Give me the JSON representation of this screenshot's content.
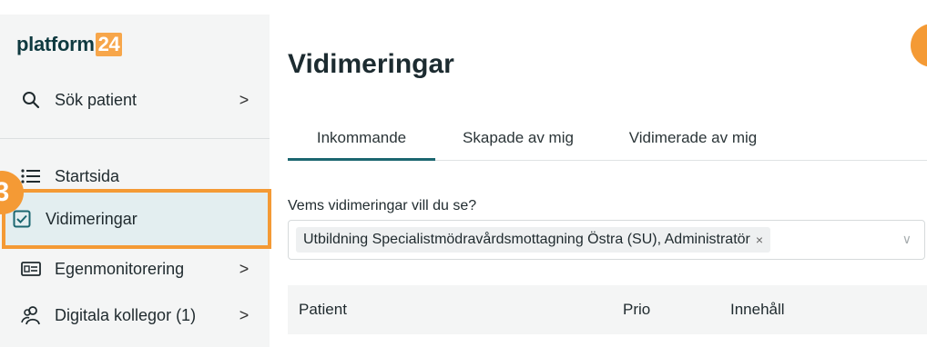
{
  "logo": {
    "text": "platform",
    "badge": "24"
  },
  "sidebar": {
    "items": [
      {
        "label": "Sök patient",
        "icon": "search-icon",
        "chevron": ">"
      },
      {
        "label": "Startsida",
        "icon": "list-icon"
      },
      {
        "label": "Vidimeringar",
        "icon": "checkbox-icon"
      },
      {
        "label": "Egenmonitorering",
        "icon": "id-card-icon",
        "chevron": ">"
      },
      {
        "label": "Digitala kollegor (1)",
        "icon": "people-icon",
        "chevron": ">"
      }
    ],
    "step_number": "3"
  },
  "main": {
    "title": "Vidimeringar",
    "tabs": [
      {
        "label": "Inkommande"
      },
      {
        "label": "Skapade av mig"
      },
      {
        "label": "Vidimerade av mig"
      }
    ],
    "filter": {
      "question": "Vems vidimeringar vill du se?",
      "selected": "Utbildning Specialistmödravårdsmottagning Östra (SU), Administratör",
      "remove_symbol": "×",
      "dropdown_symbol": "∨"
    },
    "table": {
      "headers": [
        "Patient",
        "Prio",
        "Innehåll"
      ]
    }
  },
  "colors": {
    "accent": "#f49a35",
    "teal": "#1b6670",
    "active_bg": "#e3eef0"
  }
}
